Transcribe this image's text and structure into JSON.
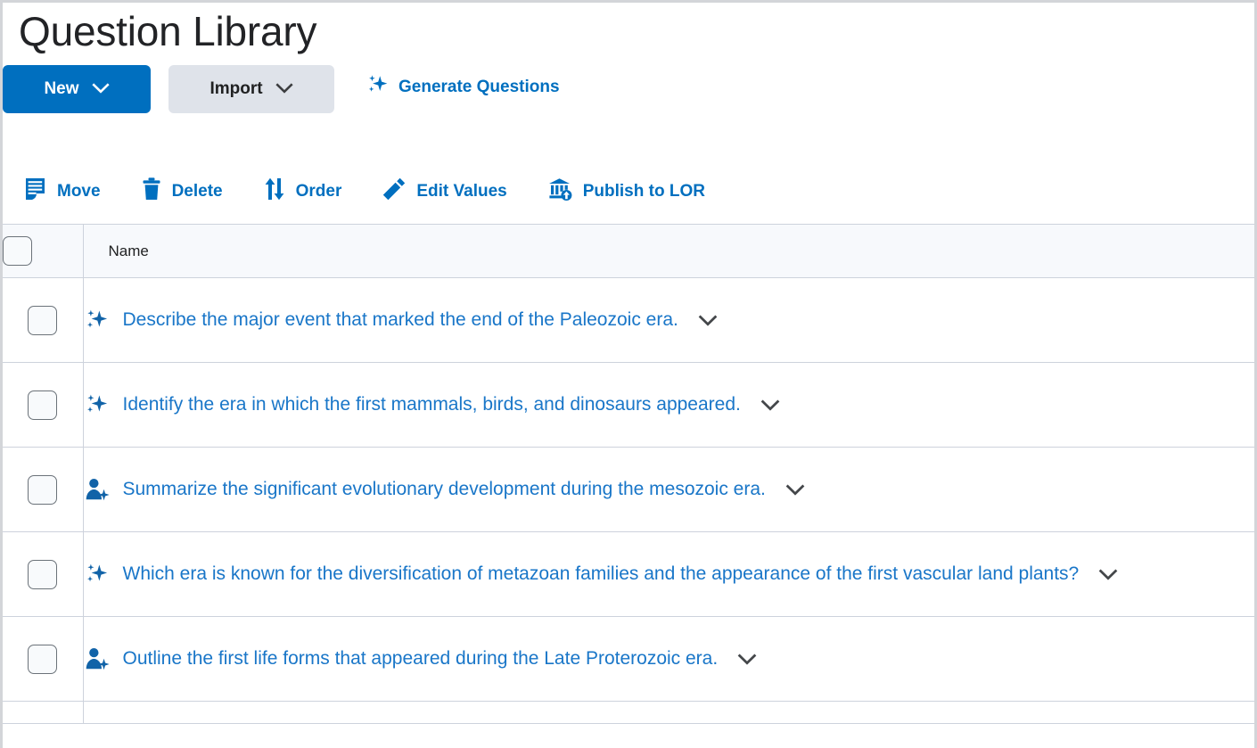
{
  "header": {
    "title": "Question Library"
  },
  "actions": {
    "new_label": "New",
    "import_label": "Import",
    "generate_label": "Generate Questions",
    "new_icon": "chevron-down-icon",
    "import_icon": "chevron-down-icon",
    "generate_icon": "sparkle-icon"
  },
  "toolbar": {
    "items": [
      {
        "label": "Move",
        "icon": "move-document-icon"
      },
      {
        "label": "Delete",
        "icon": "trash-icon"
      },
      {
        "label": "Order",
        "icon": "sort-arrows-icon"
      },
      {
        "label": "Edit Values",
        "icon": "pencil-icon"
      },
      {
        "label": "Publish to LOR",
        "icon": "publish-building-icon"
      }
    ]
  },
  "table": {
    "columns": {
      "select_all": "",
      "name": "Name"
    },
    "rows": [
      {
        "icon": "sparkle-icon",
        "name": "Describe the major event that marked the end of the Paleozoic era.",
        "chevron": "chevron-down-icon",
        "checked": false
      },
      {
        "icon": "sparkle-icon",
        "name": "Identify the era in which the first mammals, birds, and dinosaurs appeared.",
        "chevron": "chevron-down-icon",
        "checked": false
      },
      {
        "icon": "person-sparkle-icon",
        "name": "Summarize the significant evolutionary development during the mesozoic era.",
        "chevron": "chevron-down-icon",
        "checked": false
      },
      {
        "icon": "sparkle-icon",
        "name": "Which era is known for the diversification of metazoan families and the appearance of the first vascular land plants?",
        "chevron": "chevron-down-icon",
        "checked": false
      },
      {
        "icon": "person-sparkle-icon",
        "name": "Outline the first life forms that appeared during the Late Proterozoic era.",
        "chevron": "chevron-down-icon",
        "checked": false
      }
    ]
  },
  "colors": {
    "primary_blue": "#006fbf",
    "link_blue": "#1976c8",
    "button_secondary": "#dfe3ea",
    "header_row": "#f7f9fc",
    "border": "#cdd2dc",
    "title_text": "#222326"
  }
}
